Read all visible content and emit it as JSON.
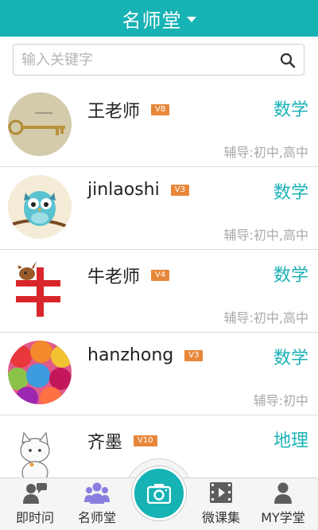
{
  "header": {
    "title": "名师堂"
  },
  "search": {
    "placeholder": "输入关键字"
  },
  "teachers": [
    {
      "name": "王老师",
      "level": "V8",
      "subject": "数学",
      "tutoring": "辅导:初中,高中"
    },
    {
      "name": "jinlaoshi",
      "level": "V3",
      "subject": "数学",
      "tutoring": "辅导:初中,高中"
    },
    {
      "name": "牛老师",
      "level": "V4",
      "subject": "数学",
      "tutoring": "辅导:初中,高中"
    },
    {
      "name": "hanzhong",
      "level": "V3",
      "subject": "数学",
      "tutoring": "辅导:初中"
    },
    {
      "name": "齐墨",
      "level": "V10",
      "subject": "地理",
      "tutoring": ""
    }
  ],
  "tabbar": {
    "tabs": [
      {
        "label": "即时问",
        "icon": "person-chat-icon"
      },
      {
        "label": "名师堂",
        "icon": "group-icon"
      },
      {
        "label": "",
        "icon": "camera-icon"
      },
      {
        "label": "微课集",
        "icon": "video-icon"
      },
      {
        "label": "MY学堂",
        "icon": "user-icon"
      }
    ]
  },
  "colors": {
    "accent": "#16b2b4",
    "badge": "#e8873a",
    "subject": "#1bb2b7",
    "active_tab_icon": "#8a7fe0"
  }
}
